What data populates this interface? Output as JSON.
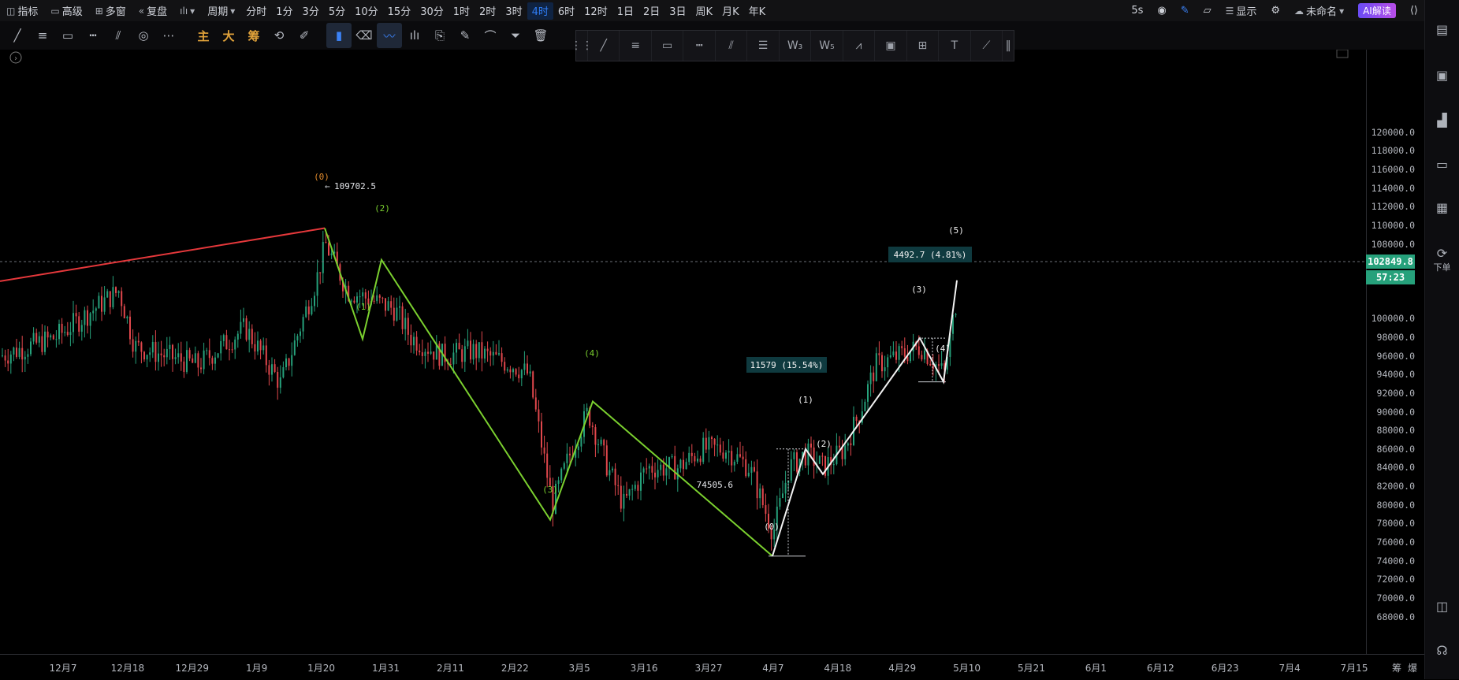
{
  "topbar": {
    "indicators": "指标",
    "advanced": "高级",
    "multi_window": "多窗",
    "replay": "复盘",
    "period": "周期",
    "periods": [
      "分时",
      "1分",
      "3分",
      "5分",
      "10分",
      "15分",
      "30分",
      "1时",
      "2时",
      "3时",
      "4时",
      "6时",
      "12时",
      "1日",
      "2日",
      "3日",
      "周K",
      "月K",
      "年K"
    ],
    "active_period": "4时",
    "refresh": "5s",
    "display": "显示",
    "unnamed": "未命名",
    "ai": "AI解读"
  },
  "toolbar2": {
    "main": "主",
    "big": "大",
    "chips": "筹"
  },
  "sidebar": {
    "order_label": "下单"
  },
  "x_axis_labels": [
    "12月7",
    "12月18",
    "12月29",
    "1月9",
    "1月20",
    "1月31",
    "2月11",
    "2月22",
    "3月5",
    "3月16",
    "3月27",
    "4月7",
    "4月18",
    "4月29",
    "5月10",
    "5月21",
    "6月1",
    "6月12",
    "6月23",
    "7月4",
    "7月15"
  ],
  "x_axis_extras": [
    "筹",
    "爆"
  ],
  "chart_data": {
    "type": "candlestick",
    "y_ticks": [
      "120000.0",
      "118000.0",
      "116000.0",
      "114000.0",
      "112000.0",
      "110000.0",
      "108000.0",
      "106000.0",
      "104000.0",
      "100000.0",
      "98000.0",
      "96000.0",
      "94000.0",
      "92000.0",
      "90000.0",
      "88000.0",
      "86000.0",
      "84000.0",
      "82000.0",
      "80000.0",
      "78000.0",
      "76000.0",
      "74000.0",
      "72000.0",
      "70000.0",
      "68000.0"
    ],
    "ylim": [
      67500,
      121000
    ],
    "current_price": "102849.8",
    "countdown": "57:23",
    "annotations": {
      "high_label": "109702.5",
      "low_label": "74505.6",
      "measure1": "11579 (15.54%)",
      "measure2": "4492.7 (4.81%)"
    },
    "wave_labels": {
      "red_0": "(0)",
      "green_1": "(1)",
      "green_2": "(2)",
      "green_3": "(3)",
      "green_4": "(4)",
      "white_0": "(0)",
      "white_1": "(1)",
      "white_2": "(2)",
      "white_3": "(3)",
      "white_4": "(4)",
      "white_5": "(5)"
    },
    "red_trendline": [
      [
        0,
        104000
      ],
      [
        412,
        109702.5
      ]
    ],
    "green_waves": [
      [
        412,
        109702.5
      ],
      [
        460,
        97800
      ],
      [
        484,
        106300
      ],
      [
        698,
        78400
      ],
      [
        752,
        91100
      ],
      [
        980,
        74505.6
      ]
    ],
    "white_waves": [
      [
        980,
        74505.6
      ],
      [
        1022,
        86000
      ],
      [
        1044,
        83300
      ],
      [
        1167,
        97900
      ],
      [
        1197,
        93200
      ],
      [
        1214,
        104100
      ]
    ],
    "colors": {
      "up": "#26a17b",
      "down": "#e0474c",
      "red_line": "#e5383b",
      "green_line": "#7bd02f",
      "white_line": "#f2f2f2"
    }
  }
}
